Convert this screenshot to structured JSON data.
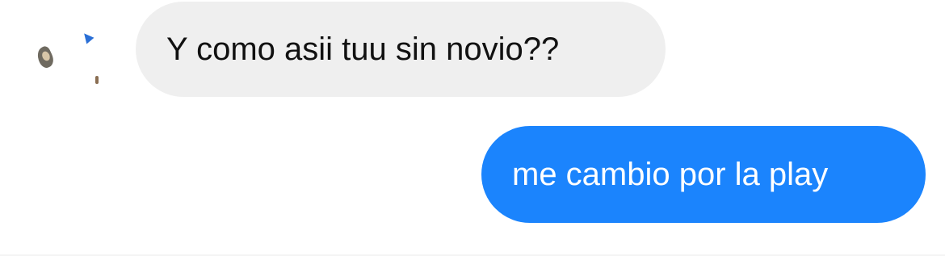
{
  "conversation": {
    "messages": [
      {
        "direction": "incoming",
        "text": "Y como asii tuu sin novio??"
      },
      {
        "direction": "outgoing",
        "text": "me cambio por la play"
      }
    ]
  },
  "colors": {
    "incoming_bubble": "#efefef",
    "incoming_text": "#111111",
    "outgoing_bubble": "#1b84fd",
    "outgoing_text": "#ffffff",
    "background": "#ffffff"
  },
  "icons": {
    "avatar": "contact-avatar-icon"
  }
}
